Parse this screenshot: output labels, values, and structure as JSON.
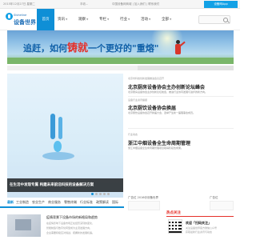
{
  "topbar": {
    "date": "2015年12月27日 星期二",
    "notice": "丰收...",
    "links": "中国设备网商城 | 加入我们 | 联系我们",
    "app_label": "设备网App"
  },
  "brand": {
    "logo_en": "Shineline",
    "logo_cn": "设备世界",
    "accent": "#0f8fd6"
  },
  "nav": {
    "items": [
      {
        "label": "首页"
      },
      {
        "label": "资讯"
      },
      {
        "label": "观察"
      },
      {
        "label": "专栏"
      },
      {
        "label": "行业"
      },
      {
        "label": "活动"
      },
      {
        "label": "全部"
      }
    ]
  },
  "search": {
    "placeholder": ""
  },
  "banner": {
    "text_part1": "追赶，如何",
    "text_highlight": "铸就",
    "text_part2": "一个更好的\"重熔\""
  },
  "slideshow": {
    "caption": "在生活中发现专属 构建未来前沿科技的设备解决方案"
  },
  "featured": [
    {
      "sub": "北京市科技创新发展推进会议召开",
      "title": "北京厨房设备协会主办创新论坛峰会",
      "desc": "北京厨房设备协会主办创新论坛峰会，推进行业协同发展与进步的新方向。"
    },
    {
      "sub": "设备行业资讯播报",
      "title": "北京厨饮设备协会换届",
      "desc": "北京厨饮设备协会召开换届大会，选举产生新一届理事会成员。"
    },
    {
      "sub": "行业动态",
      "title": "浙江中烟设备全生命周期管理",
      "desc": "浙江中烟设备全生命周期管理项目取得阶段性成果。"
    }
  ],
  "tabs": [
    "最新",
    "工业制造",
    "农业生产",
    "商业服务",
    "零售终端",
    "行业标准",
    "政策解读",
    "国际",
    "新型设备",
    "产品品牌"
  ],
  "news": {
    "title": "疫情背景下设备市场的新格局和趋势",
    "lines": [
      "在疫情影响下设备市场正在经历深刻的变化，",
      "智能制造与数字化转型成为主流发展方向，",
      "企业需要积极应对挑战，把握新的发展机遇。"
    ]
  },
  "ads": [
    {
      "label": "广告位 2016@设备世界"
    },
    {
      "label": "广告位"
    }
  ],
  "hot": {
    "header": "热点关注",
    "qr_title": "欢迎「扫码关注」",
    "qr_desc": [
      "关注设备世界官方微信公众号",
      "获取最新行业资讯与动态"
    ]
  }
}
